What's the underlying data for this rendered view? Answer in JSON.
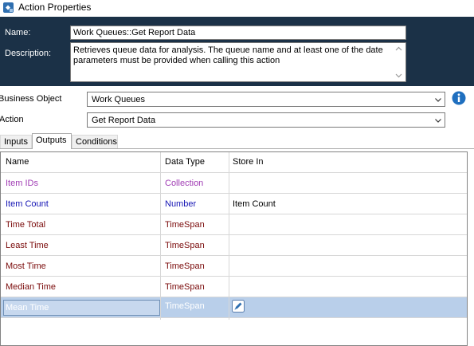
{
  "window": {
    "title": "Action Properties"
  },
  "header": {
    "name_label": "Name:",
    "name_value": "Work Queues::Get Report Data",
    "description_label": "Description:",
    "description_value": "Retrieves queue data for analysis. The queue name and at least one of the date parameters must be provided when calling this action"
  },
  "business_object": {
    "label": "Business Object",
    "value": "Work Queues"
  },
  "action": {
    "label": "Action",
    "value": "Get Report Data"
  },
  "tabs": [
    {
      "label": "Inputs"
    },
    {
      "label": "Outputs",
      "active": true
    },
    {
      "label": "Conditions"
    }
  ],
  "grid": {
    "columns": [
      "Name",
      "Data Type",
      "Store In"
    ],
    "rows": [
      {
        "name": "Item IDs",
        "type": "Collection",
        "store": "",
        "color": "#a03cb4"
      },
      {
        "name": "Item Count",
        "type": "Number",
        "store": "Item Count",
        "color": "#1414b4"
      },
      {
        "name": "Time Total",
        "type": "TimeSpan",
        "store": "",
        "color": "#7a0a0a"
      },
      {
        "name": "Least Time",
        "type": "TimeSpan",
        "store": "",
        "color": "#7a0a0a"
      },
      {
        "name": "Most Time",
        "type": "TimeSpan",
        "store": "",
        "color": "#7a0a0a"
      },
      {
        "name": "Median Time",
        "type": "TimeSpan",
        "store": "",
        "color": "#7a0a0a"
      },
      {
        "name": "Mean Time",
        "type": "TimeSpan",
        "store": "",
        "color": "#ffffff",
        "selected": true
      }
    ]
  },
  "colors": {
    "header_bg": "#1b3147",
    "selection_bg": "#b9cfea",
    "info_icon": "#1f6fbf"
  },
  "icons": {
    "app": "action-properties-icon",
    "info": "info-icon",
    "dropdown": "chevron-down-icon",
    "store": "store-in-icon"
  }
}
